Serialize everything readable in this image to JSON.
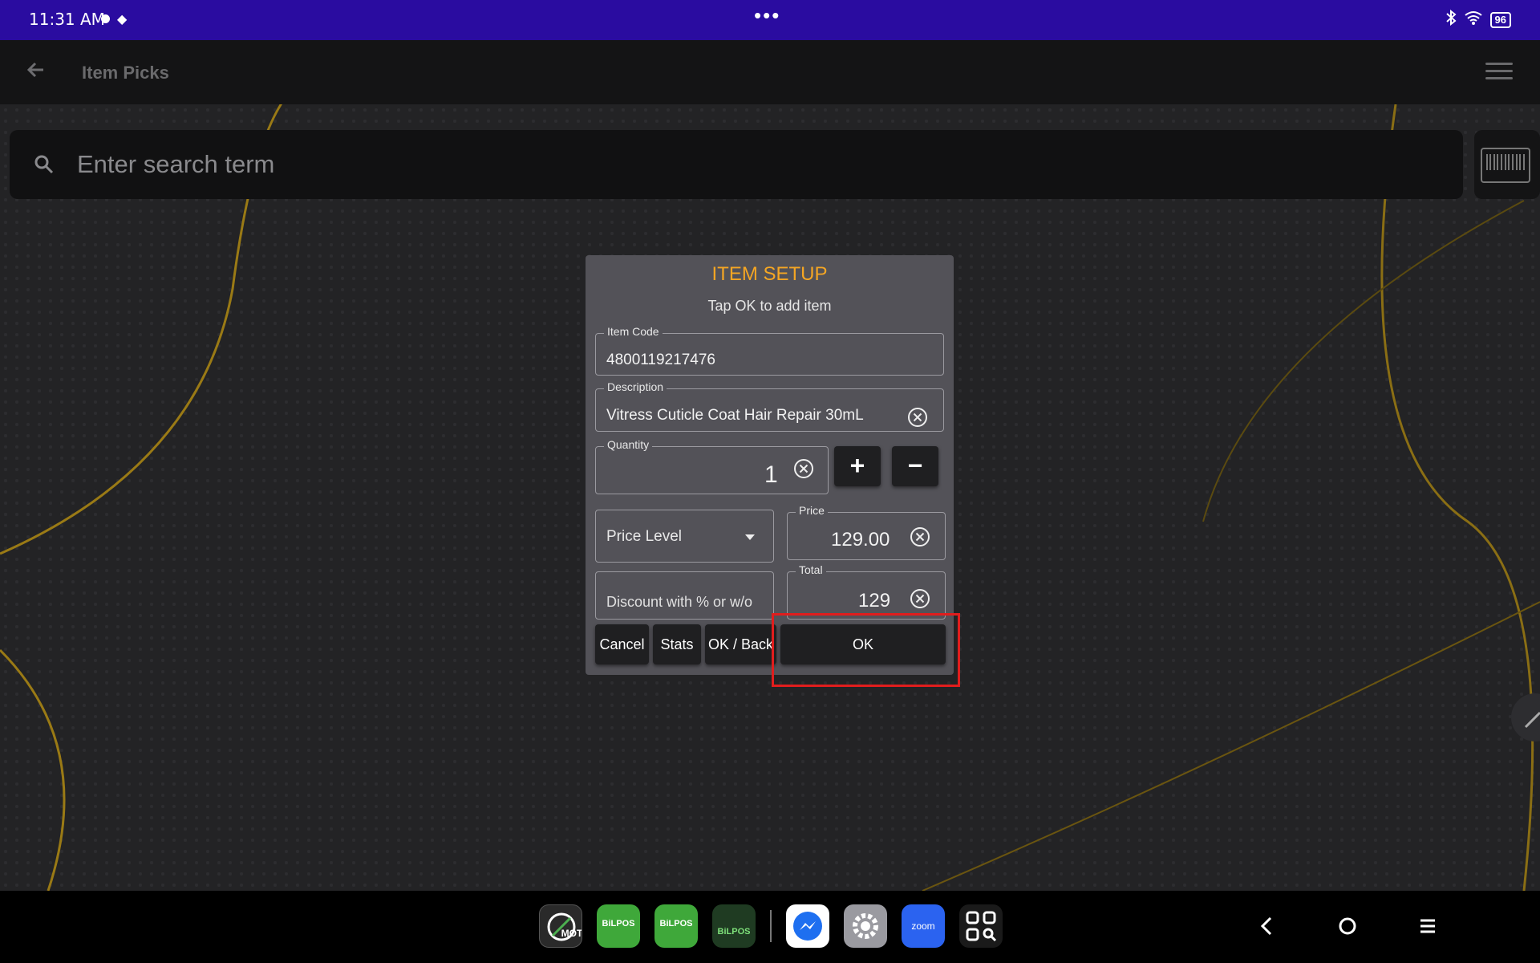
{
  "status_bar": {
    "time": "11:31 AM",
    "battery": "96"
  },
  "app_bar": {
    "title": "Item Picks"
  },
  "search": {
    "placeholder": "Enter search term"
  },
  "dialog": {
    "title": "ITEM SETUP",
    "subtitle": "Tap OK to add item",
    "item_code": {
      "label": "Item Code",
      "value": "4800119217476"
    },
    "description": {
      "label": "Description",
      "value": "Vitress Cuticle Coat Hair Repair 30mL"
    },
    "quantity": {
      "label": "Quantity",
      "value": "1"
    },
    "price_level": {
      "placeholder": "Price Level"
    },
    "price": {
      "label": "Price",
      "value": "129.00"
    },
    "discount": {
      "placeholder": "Discount with % or w/o"
    },
    "total": {
      "label": "Total",
      "value": "129"
    },
    "plus_label": "+",
    "minus_label": "−",
    "buttons": {
      "cancel": "Cancel",
      "stats": "Stats",
      "ok_back": "OK / Back",
      "ok": "OK"
    }
  },
  "dock": {
    "apps": [
      {
        "name": "MOT",
        "label": "MOT"
      },
      {
        "name": "BillPOS",
        "label": "BiLPOS"
      },
      {
        "name": "BillPOS Attendance",
        "label": "BiLPOS"
      },
      {
        "name": "BillPOS Terminal",
        "label": "BiLPOS"
      },
      {
        "name": "Messenger",
        "label": ""
      },
      {
        "name": "Settings",
        "label": ""
      },
      {
        "name": "Zoom",
        "label": "zoom"
      },
      {
        "name": "App Drawer",
        "label": ""
      }
    ]
  },
  "colors": {
    "status_bar": "#2a0ca0",
    "dialog_title": "#f5a623",
    "highlight": "#e11d1d",
    "dialog_bg": "#535258"
  }
}
